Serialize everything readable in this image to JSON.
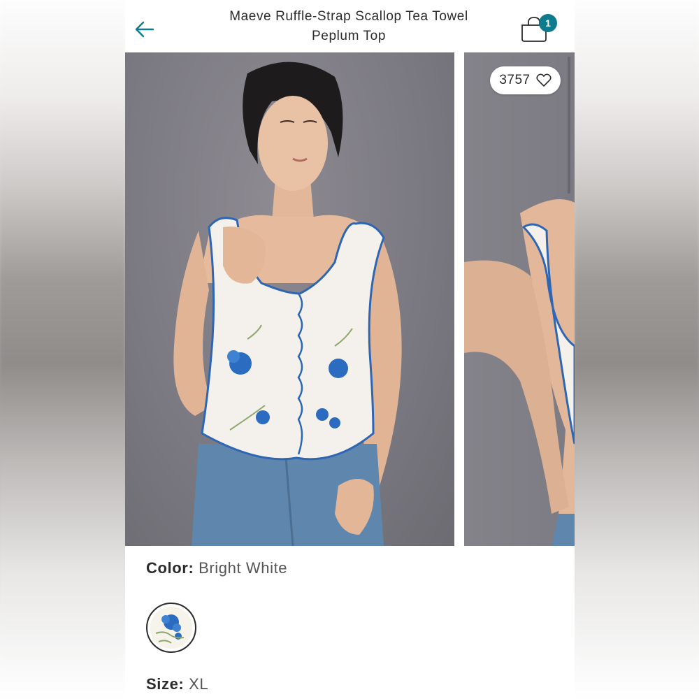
{
  "header": {
    "title_line1": "Maeve Ruffle-Strap Scallop Tea Towel",
    "title_line2": "Peplum Top",
    "cart_count": "1",
    "back_icon": "arrow-left-icon",
    "cart_icon": "shopping-bag-icon"
  },
  "gallery": {
    "likes_count": "3757",
    "like_icon": "heart-outline-icon",
    "images": [
      "product-photo-front",
      "product-photo-back"
    ]
  },
  "product": {
    "color_label": "Color:",
    "color_value": "Bright White",
    "size_label": "Size:",
    "size_value": "XL"
  },
  "colors": {
    "accent": "#0e7b8c",
    "text": "#2b2b2b",
    "photo_bg": "#7a7880"
  }
}
